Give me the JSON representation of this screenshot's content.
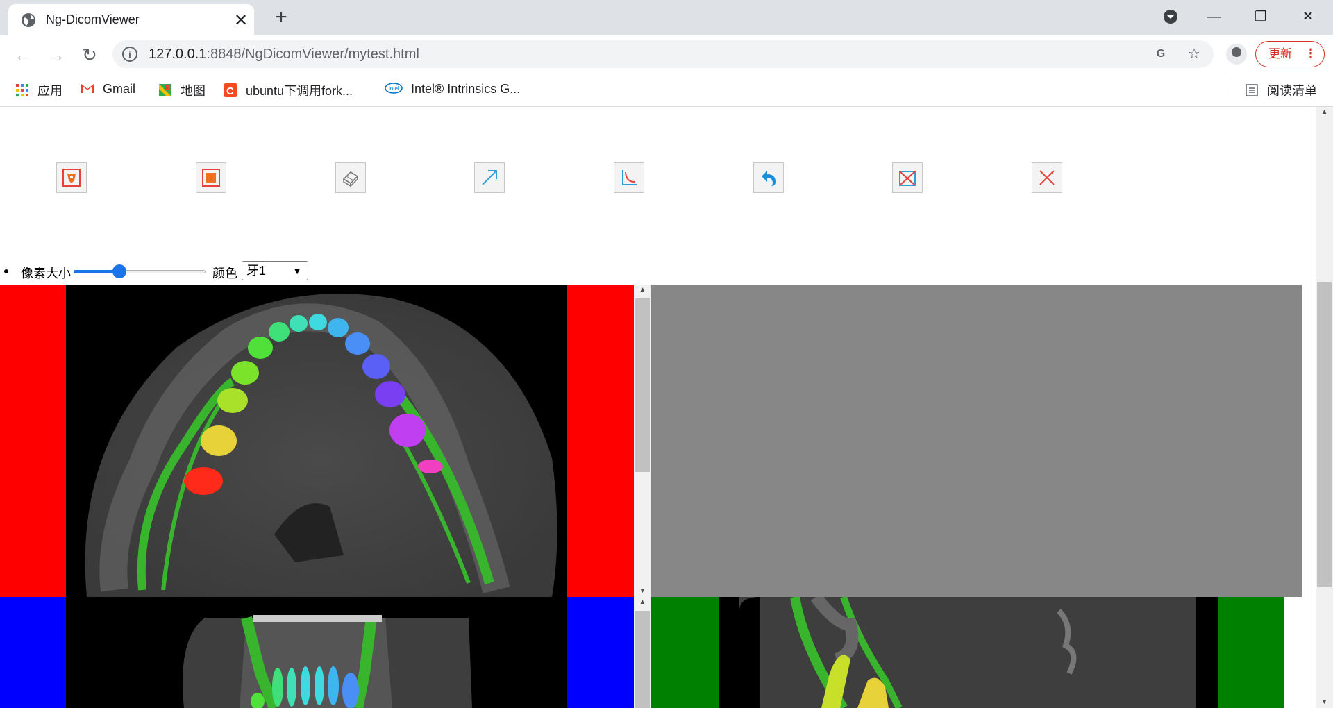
{
  "browser": {
    "tab_title": "Ng-DicomViewer",
    "tab_close": "✕",
    "new_tab": "+",
    "url_host": "127.0.0.1",
    "url_rest": ":8848/NgDicomViewer/mytest.html",
    "update_label": "更新",
    "window_minimize": "—",
    "window_restore": "❐",
    "window_close": "✕"
  },
  "bookmarks": [
    {
      "label": "应用",
      "icon": "apps-grid-icon"
    },
    {
      "label": "Gmail",
      "icon": "gmail-icon"
    },
    {
      "label": "地图",
      "icon": "maps-icon"
    },
    {
      "label": "ubuntu下调用fork...",
      "icon": "csdn-icon"
    },
    {
      "label": "Intel® Intrinsics G...",
      "icon": "intel-icon"
    }
  ],
  "reading_list": "阅读清单",
  "tools": [
    {
      "name": "roi-tool",
      "icon": "brush-shield-icon",
      "color": "#e8413c"
    },
    {
      "name": "rect-tool",
      "icon": "square-fill-icon",
      "color": "#f07020"
    },
    {
      "name": "eraser-tool",
      "icon": "eraser-icon",
      "color": "#777777"
    },
    {
      "name": "arrow-tool",
      "icon": "arrow-icon",
      "color": "#2aa0d8"
    },
    {
      "name": "angle-tool",
      "icon": "angle-icon",
      "color": "#2aa0d8"
    },
    {
      "name": "undo-tool",
      "icon": "undo-icon",
      "color": "#1a8fd8"
    },
    {
      "name": "clear-tool",
      "icon": "clear-box-icon",
      "color": "#e8413c"
    },
    {
      "name": "close-tool",
      "icon": "x-icon",
      "color": "#e8413c"
    }
  ],
  "controls": {
    "pixel_size_label": "像素大小",
    "pixel_size_value": 0.33,
    "color_label": "颜色",
    "color_selected": "牙1"
  },
  "views": {
    "axial_border": "#ff0000",
    "coronal_border": "#0000ff",
    "sagittal_border": "#008000",
    "empty_view_bg": "#878787"
  }
}
